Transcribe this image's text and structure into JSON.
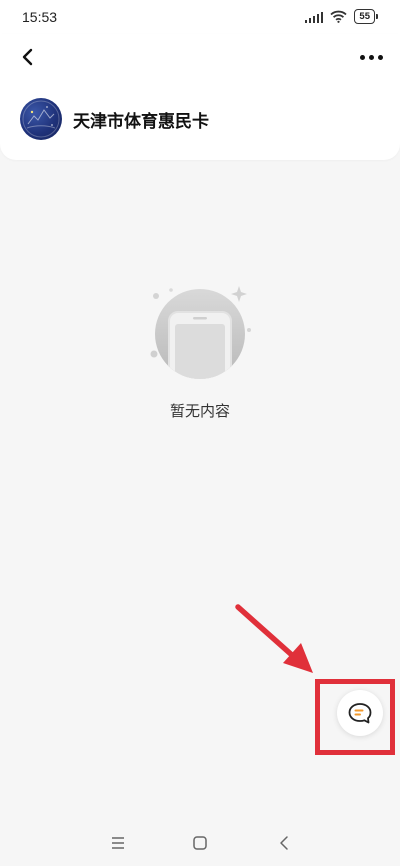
{
  "status_bar": {
    "time": "15:53",
    "battery": "55"
  },
  "header": {
    "account_name": "天津市体育惠民卡",
    "back_icon": "chevron-left-icon",
    "more_icon": "more-dots-icon"
  },
  "empty_state": {
    "text": "暂无内容",
    "illustration_icon": "empty-phone-icon"
  },
  "chat_button": {
    "icon": "chat-bubble-icon",
    "accent_color": "#f29a2e"
  },
  "annotation": {
    "color": "#e0303a"
  },
  "nav_bar": {
    "items": [
      "menu-icon",
      "home-square-icon",
      "back-triangle-icon"
    ]
  }
}
